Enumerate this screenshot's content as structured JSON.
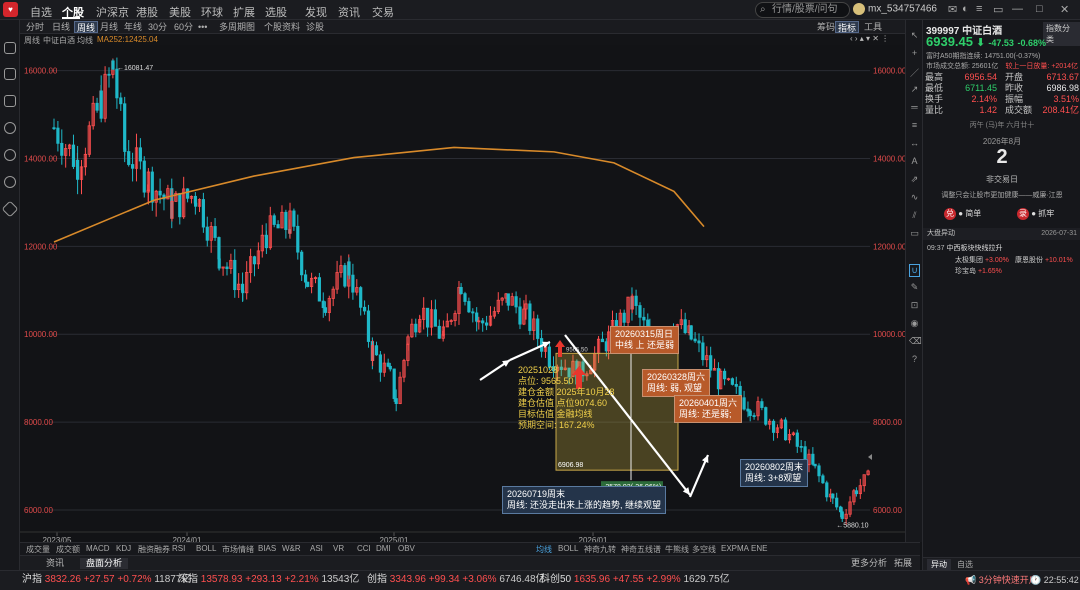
{
  "nav": {
    "items": [
      "自选",
      "个股",
      "沪深京",
      "港股",
      "美股",
      "环球",
      "扩展",
      "选股",
      "发现",
      "资讯",
      "交易"
    ],
    "active": "个股"
  },
  "search": {
    "placeholder": "行情/股票/问句"
  },
  "user": {
    "name": "mx_534757466"
  },
  "periods": [
    "分时",
    "日线",
    "周线",
    "月线",
    "年线",
    "30分",
    "60分",
    "•••",
    "多周期图",
    "个股资料",
    "诊股"
  ],
  "period_active": "周线",
  "tb_right": [
    "筹码",
    "指标",
    "工具"
  ],
  "subtitle": {
    "mode": "周线",
    "name": "中证白酒",
    "ma": "均线",
    "ma252": "MA252:12425.04"
  },
  "chart_data": {
    "type": "candlestick",
    "title": "中证白酒 周线",
    "y_ticks": [
      "16000.00",
      "14000.00",
      "12000.00",
      "10000.00",
      "8000.00",
      "6000.00"
    ],
    "x_ticks": [
      "2023/05",
      "2024/01",
      "2025/01",
      "2026/01"
    ],
    "high_label": "16081.47",
    "low_label": "5880.10",
    "ma252": [
      [
        0,
        12100
      ],
      [
        100,
        13050
      ],
      [
        200,
        13600
      ],
      [
        300,
        14020
      ],
      [
        400,
        14250
      ],
      [
        500,
        14150
      ],
      [
        560,
        13900
      ],
      [
        620,
        13250
      ],
      [
        650,
        12450
      ]
    ],
    "close_path": [
      [
        0,
        14700
      ],
      [
        20,
        13900
      ],
      [
        40,
        15300
      ],
      [
        50,
        16081
      ],
      [
        60,
        14200
      ],
      [
        80,
        13500
      ],
      [
        100,
        12900
      ],
      [
        120,
        13200
      ],
      [
        140,
        11800
      ],
      [
        160,
        11000
      ],
      [
        180,
        12300
      ],
      [
        200,
        12500
      ],
      [
        215,
        11200
      ],
      [
        230,
        10800
      ],
      [
        250,
        11500
      ],
      [
        270,
        9600
      ],
      [
        285,
        9000
      ],
      [
        290,
        8500
      ],
      [
        300,
        9900
      ],
      [
        310,
        10600
      ],
      [
        330,
        9900
      ],
      [
        345,
        11200
      ],
      [
        360,
        10200
      ],
      [
        385,
        10800
      ],
      [
        400,
        10400
      ],
      [
        420,
        9500
      ],
      [
        445,
        9100
      ],
      [
        470,
        9900
      ],
      [
        490,
        10700
      ],
      [
        505,
        9900
      ],
      [
        525,
        10300
      ],
      [
        540,
        9900
      ],
      [
        565,
        8900
      ],
      [
        590,
        8400
      ],
      [
        620,
        7800
      ],
      [
        645,
        6900
      ],
      [
        660,
        6200
      ],
      [
        668,
        5880
      ],
      [
        680,
        6500
      ],
      [
        690,
        6700
      ]
    ],
    "ytick_values": [
      16000,
      14000,
      12000,
      10000,
      8000,
      6000
    ],
    "xtick_positions": [
      37,
      167,
      374,
      573
    ],
    "box": {
      "top": 9565.5,
      "bottom": 6906.98,
      "x0": 536,
      "x1": 658,
      "label": "6906.98",
      "top_label": "9565.50"
    },
    "drop_label": "-2578.92(-26.96%)"
  },
  "annotations": {
    "a1": [
      "20251028",
      "点位: 9565.50",
      "建仓金额 2025年10月28",
      "建仓估值 点位9074.60",
      "目标估值 金融均线",
      "预期空间: 167.24%"
    ],
    "a2": [
      "20260315周日",
      "中线 上 还是弱"
    ],
    "a3": [
      "20260328周六",
      "周线: 弱, 观望"
    ],
    "a4": [
      "20260401周六",
      "周线: 还是弱;"
    ],
    "a5": [
      "20260719周末",
      "周线: 还没走出来上涨的趋势, 继续观望"
    ],
    "a6": [
      "20260802周末",
      "周线: 3+8观望"
    ]
  },
  "indicator_tabs": [
    "成交量",
    "成交额",
    "MACD",
    "KDJ",
    "融资融券",
    "RSI",
    "BOLL",
    "市场情绪",
    "BIAS",
    "W&R",
    "ASI",
    "VR",
    "CCI",
    "DMI",
    "OBV"
  ],
  "indicator_tabs2": [
    "均线",
    "BOLL",
    "神奇九转",
    "神奇五线谱",
    "牛熊线",
    "多空线",
    "EXPMA",
    "ENE"
  ],
  "indicator_active": "均线",
  "cards": [
    "资讯",
    "盘面分析"
  ],
  "cards_right": [
    "更多分析",
    "拓展"
  ],
  "quote": {
    "code": "399997",
    "name": "中证白酒",
    "btn": "指数分类",
    "price": "6939.45",
    "change": "-47.53",
    "pct": "-0.68%",
    "futures": "富时A50期指连续: 14751.00(-0.37%)",
    "volline_l": "市场成交总额: 25601亿",
    "volline_r": "较上一日放量: +2014亿",
    "rows": [
      {
        "l": "最高",
        "lv": "6956.54",
        "r": "开盘",
        "rv": "6713.67"
      },
      {
        "l": "最低",
        "lv": "6711.45",
        "r": "昨收",
        "rv": "6986.98"
      },
      {
        "l": "换手",
        "lv": "2.14%",
        "r": "振幅",
        "rv": "3.51%"
      },
      {
        "l": "量比",
        "lv": "1.42",
        "r": "成交额",
        "rv": "208.41亿"
      }
    ]
  },
  "calendar": {
    "lunar": "丙午 (马)年 六月廿十",
    "month": "2026年8月",
    "day": "2",
    "note": "非交易日",
    "tip": "调整只会让股市更加健康——威廉·江恩"
  },
  "buttons": {
    "buy": "简单",
    "sell": "抓牢"
  },
  "news": {
    "title": "大盘异动",
    "date": "2026-07-31",
    "time": "09:37",
    "headline": "中西板块快线拉升",
    "stocks": [
      {
        "n": "太极集团",
        "v": "+3.00%"
      },
      {
        "n": "康恩股份",
        "v": "+10.01%"
      },
      {
        "n": "珍宝岛",
        "v": "+1.65%"
      }
    ]
  },
  "right_tabs": [
    "异动",
    "自选"
  ],
  "status": [
    {
      "n": "沪指",
      "p": "3832.26",
      "c": "+27.57",
      "pc": "+0.72%",
      "v": "11877亿"
    },
    {
      "n": "深指",
      "p": "13578.93",
      "c": "+293.13",
      "pc": "+2.21%",
      "v": "13543亿"
    },
    {
      "n": "创指",
      "p": "3343.96",
      "c": "+99.34",
      "pc": "+3.06%",
      "v": "6746.48亿"
    },
    {
      "n": "科创50",
      "p": "1635.96",
      "c": "+47.55",
      "pc": "+2.99%",
      "v": "1629.75亿"
    }
  ],
  "status_right": {
    "news": "3分钟快速开户",
    "time": "22:55:42"
  },
  "colors": {
    "up": "#ff4f4f",
    "down": "#1fb8c8",
    "ma": "#d88a2a",
    "accent": "#4aa3df"
  }
}
